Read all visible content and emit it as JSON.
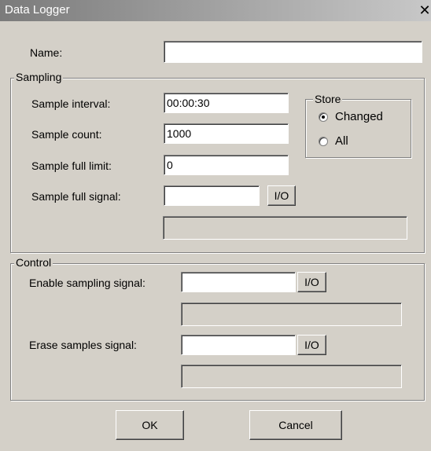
{
  "window": {
    "title": "Data Logger"
  },
  "name": {
    "label": "Name:",
    "value": ""
  },
  "sampling": {
    "legend": "Sampling",
    "interval": {
      "label": "Sample interval:",
      "value": "00:00:30"
    },
    "count": {
      "label": "Sample count:",
      "value": "1000"
    },
    "full_limit": {
      "label": "Sample full limit:",
      "value": "0"
    },
    "full_signal": {
      "label": "Sample full signal:",
      "value": "",
      "io_label": "I/O",
      "display": ""
    }
  },
  "store": {
    "legend": "Store",
    "options": [
      {
        "label": "Changed",
        "selected": true
      },
      {
        "label": "All",
        "selected": false
      }
    ]
  },
  "control": {
    "legend": "Control",
    "enable": {
      "label": "Enable sampling signal:",
      "value": "",
      "io_label": "I/O",
      "display": ""
    },
    "erase": {
      "label": "Erase samples signal:",
      "value": "",
      "io_label": "I/O",
      "display": ""
    }
  },
  "buttons": {
    "ok": "OK",
    "cancel": "Cancel"
  }
}
